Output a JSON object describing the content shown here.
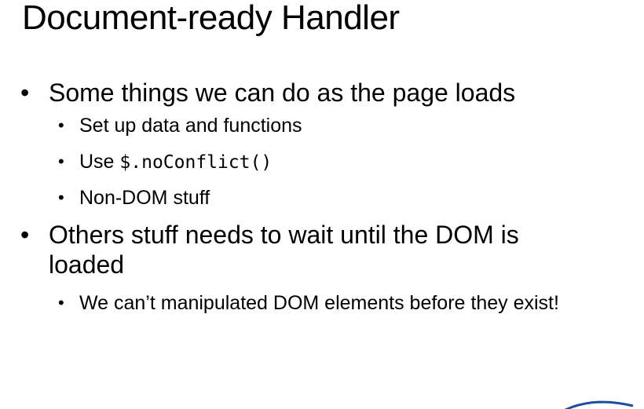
{
  "slide": {
    "title": "Document-ready Handler",
    "bullets": [
      {
        "level": 1,
        "text": "Some things we can do as the page loads"
      },
      {
        "level": 2,
        "text": "Set up data and functions"
      },
      {
        "level": 2,
        "prefix": "Use ",
        "code": "$.noConflict()"
      },
      {
        "level": 2,
        "text": "Non-DOM stuff"
      },
      {
        "level": 1,
        "text": "Others stuff needs to wait until the DOM is loaded"
      },
      {
        "level": 2,
        "text": "We can’t manipulated DOM elements before they exist!"
      }
    ]
  },
  "colors": {
    "background": "#ffffff",
    "text": "#000000",
    "logo_accent": "#1f4e9d"
  },
  "icons": {
    "bullet": "•",
    "corner_logo": "blue-swoosh-logo-icon"
  }
}
